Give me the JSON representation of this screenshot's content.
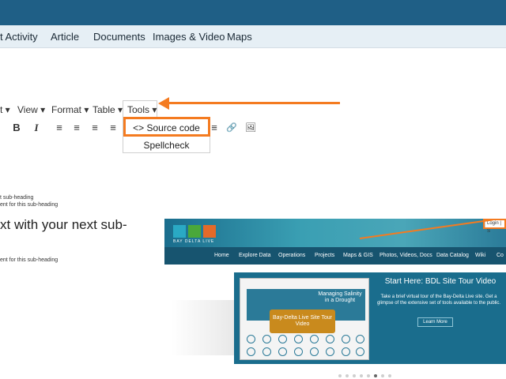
{
  "nav": {
    "items": [
      "t Activity",
      "Article",
      "Documents",
      "Images & Video",
      "Maps"
    ]
  },
  "editor": {
    "menu": [
      "t ▾",
      "View ▾",
      "Format ▾",
      "Table ▾",
      "Tools ▾"
    ],
    "toolbar": [
      "B",
      "I",
      "≡",
      "≡",
      "≡",
      "≡",
      "≡",
      "🔗",
      "🖼"
    ],
    "tools_dropdown": {
      "source_code": "<> Source code",
      "spellcheck": "Spellcheck"
    }
  },
  "content": {
    "line1": "t sub-heading",
    "line2": "ent for this sub-heading",
    "big_text": "xt with your next sub-",
    "line3": "ent for this sub-heading"
  },
  "preview": {
    "logo_text": "BAY DELTA LIVE",
    "login": "Login | S",
    "nav_items": [
      "Home",
      "Explore Data",
      "Operations",
      "Projects",
      "Maps & GIS",
      "Photos, Videos, Docs",
      "Data Catalog",
      "Wiki",
      "Co"
    ],
    "slide": {
      "screen_title": "Managing Salinity in a Drought",
      "badge": "Bay-Delta Live Site Tour Video",
      "title": "Start Here: BDL Site Tour Video",
      "description": "Take a brief virtual tour of the Bay-Delta Live site. Get a glimpse of the extensive set of tools available to the public.",
      "button": "Learn More"
    },
    "dots_count": 8,
    "active_dot": 5
  },
  "colors": {
    "topbar": "#1f5f86",
    "nav_bg": "#e6eff5",
    "annotation": "#f47b20"
  }
}
